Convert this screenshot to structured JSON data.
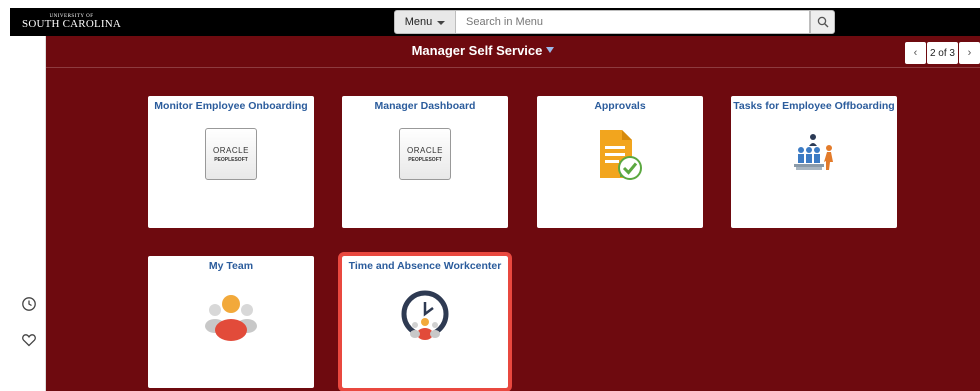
{
  "header": {
    "logo_small": "UNIVERSITY OF",
    "logo_big": "SOUTH CAROLINA",
    "menu_label": "Menu",
    "search_placeholder": "Search in Menu"
  },
  "page": {
    "title": "Manager Self Service",
    "pager": "2 of 3"
  },
  "tiles": [
    {
      "title": "Monitor Employee Onboarding",
      "icon": "oracle-peoplesoft-logo",
      "logo_line1": "ORACLE",
      "logo_line2": "PEOPLESOFT"
    },
    {
      "title": "Manager Dashboard",
      "icon": "oracle-peoplesoft-logo",
      "logo_line1": "ORACLE",
      "logo_line2": "PEOPLESOFT"
    },
    {
      "title": "Approvals",
      "icon": "document-check-icon"
    },
    {
      "title": "Tasks for Employee Offboarding",
      "icon": "team-exit-icon"
    },
    {
      "title": "My Team",
      "icon": "team-people-icon"
    },
    {
      "title": "Time and Absence Workcenter",
      "icon": "clock-team-icon",
      "selected": true
    }
  ],
  "left_rail": [
    "recent-history-icon",
    "favorites-heart-icon"
  ],
  "colors": {
    "main_bg": "#6e0a0f",
    "tile_title": "#2b5c9c",
    "selected_outline": "#e9483f"
  }
}
